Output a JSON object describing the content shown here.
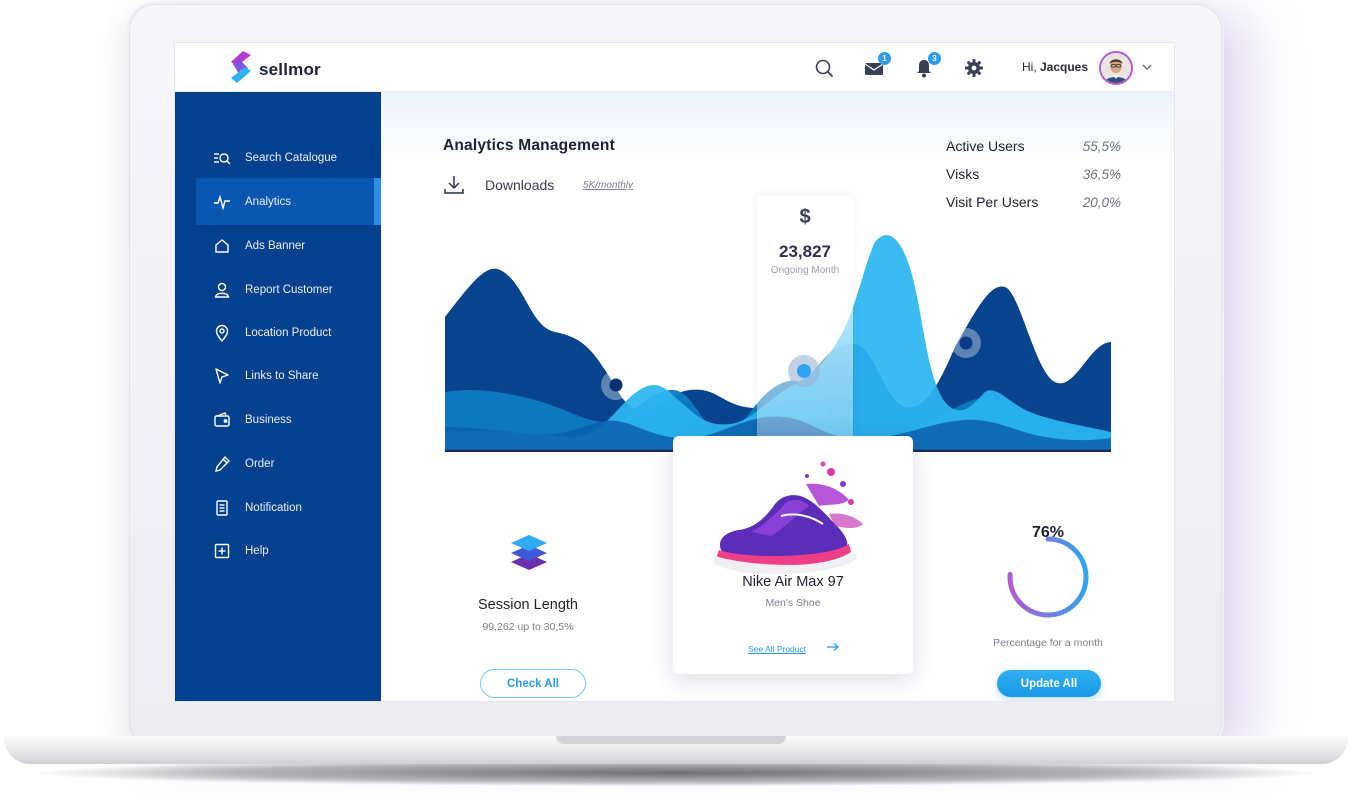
{
  "app": {
    "brand": "sellmor"
  },
  "header": {
    "greeting_prefix": "Hi, ",
    "user_name": "Jacques",
    "mail_badge": "1",
    "notif_badge": "3"
  },
  "sidebar": {
    "items": [
      {
        "label": "Search Catalogue",
        "icon": "search-catalogue-icon"
      },
      {
        "label": "Analytics",
        "icon": "analytics-icon",
        "active": true
      },
      {
        "label": "Ads Banner",
        "icon": "home-icon"
      },
      {
        "label": "Report Customer",
        "icon": "user-icon"
      },
      {
        "label": "Location Product",
        "icon": "location-pin-icon"
      },
      {
        "label": "Links to Share",
        "icon": "cursor-icon"
      },
      {
        "label": "Business",
        "icon": "wallet-icon"
      },
      {
        "label": "Order",
        "icon": "pencil-icon"
      },
      {
        "label": "Notification",
        "icon": "document-icon"
      },
      {
        "label": "Help",
        "icon": "plus-box-icon"
      }
    ]
  },
  "main": {
    "title": "Analytics Management",
    "downloads_label": "Downloads",
    "downloads_value": "5K/monthly",
    "stats": [
      {
        "label": "Active Users",
        "value": "55,5%"
      },
      {
        "label": "Visks",
        "value": "36,5%"
      },
      {
        "label": "Visit Per Users",
        "value": "20,0%"
      }
    ],
    "tooltip": {
      "symbol": "$",
      "value": "23,827",
      "label": "Ongoing Month"
    },
    "session": {
      "title": "Session Length",
      "subtitle": "99,262 up to 30,5%",
      "button": "Check All"
    },
    "product": {
      "name": "Nike Air Max 97",
      "category": "Men's Shoe",
      "link": "See All Product"
    },
    "percentage": {
      "value": "76%",
      "value_num": 76,
      "label": "Percentage for a month",
      "button": "Update All"
    }
  },
  "colors": {
    "sidebar_bg": "#03418f",
    "sidebar_active": "#0a57b1",
    "accent": "#2b9bea",
    "wave_dark": "#08438d",
    "wave_mid": "#0d7bc1",
    "wave_light": "#2bb5f2"
  }
}
